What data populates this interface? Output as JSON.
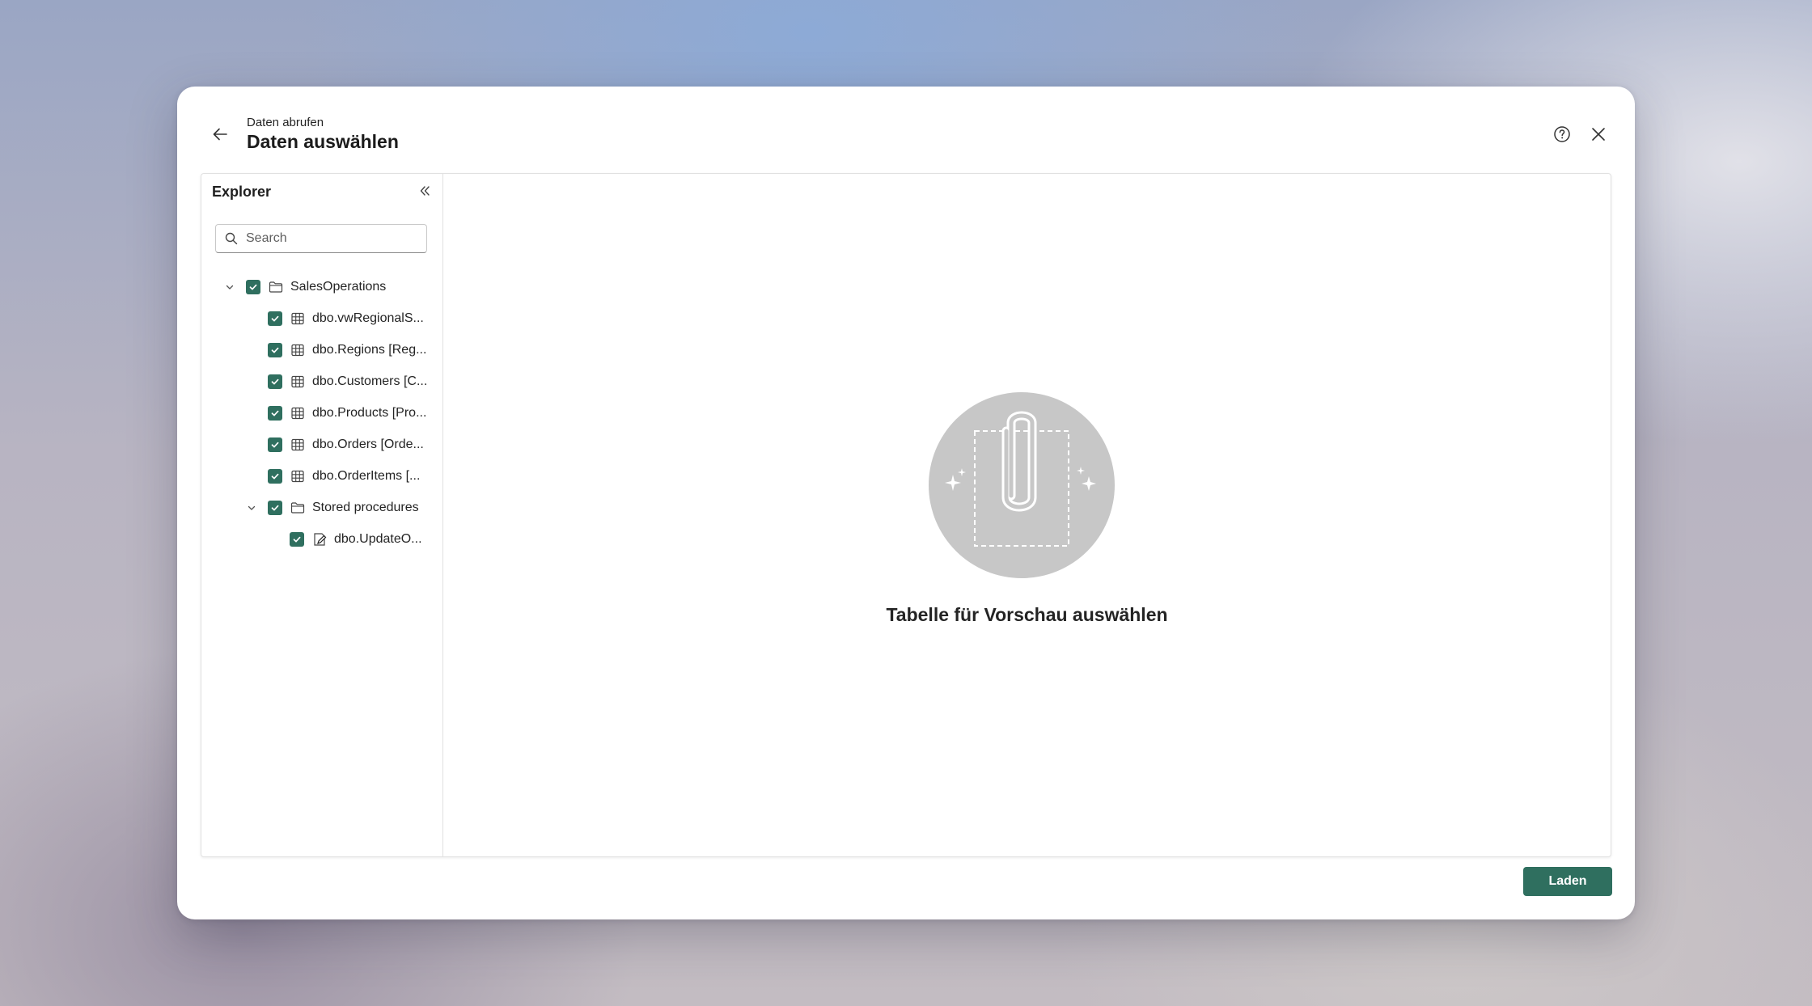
{
  "header": {
    "subtitle": "Daten abrufen",
    "title": "Daten auswählen"
  },
  "explorer": {
    "title": "Explorer",
    "search_placeholder": "Search",
    "search_value": "",
    "tree": [
      {
        "label": "SalesOperations",
        "type": "folder",
        "checked": true,
        "expanded": true,
        "level": 0
      },
      {
        "label": "dbo.vwRegionalS...",
        "type": "table",
        "checked": true,
        "level": 1
      },
      {
        "label": "dbo.Regions [Reg...",
        "type": "table",
        "checked": true,
        "level": 1
      },
      {
        "label": "dbo.Customers [C...",
        "type": "table",
        "checked": true,
        "level": 1
      },
      {
        "label": "dbo.Products [Pro...",
        "type": "table",
        "checked": true,
        "level": 1
      },
      {
        "label": "dbo.Orders [Orde...",
        "type": "table",
        "checked": true,
        "level": 1
      },
      {
        "label": "dbo.OrderItems [...",
        "type": "table",
        "checked": true,
        "level": 1
      },
      {
        "label": "Stored procedures",
        "type": "folder",
        "checked": true,
        "expanded": true,
        "level": 1
      },
      {
        "label": "dbo.UpdateO...",
        "type": "procedure",
        "checked": true,
        "level": 2
      }
    ]
  },
  "preview": {
    "message": "Tabelle für Vorschau auswählen",
    "illustration_icon": "paperclip-icon"
  },
  "footer": {
    "load_label": "Laden"
  },
  "colors": {
    "accent": "#2f6f5f",
    "illustration_bg": "#c7c7c7"
  }
}
